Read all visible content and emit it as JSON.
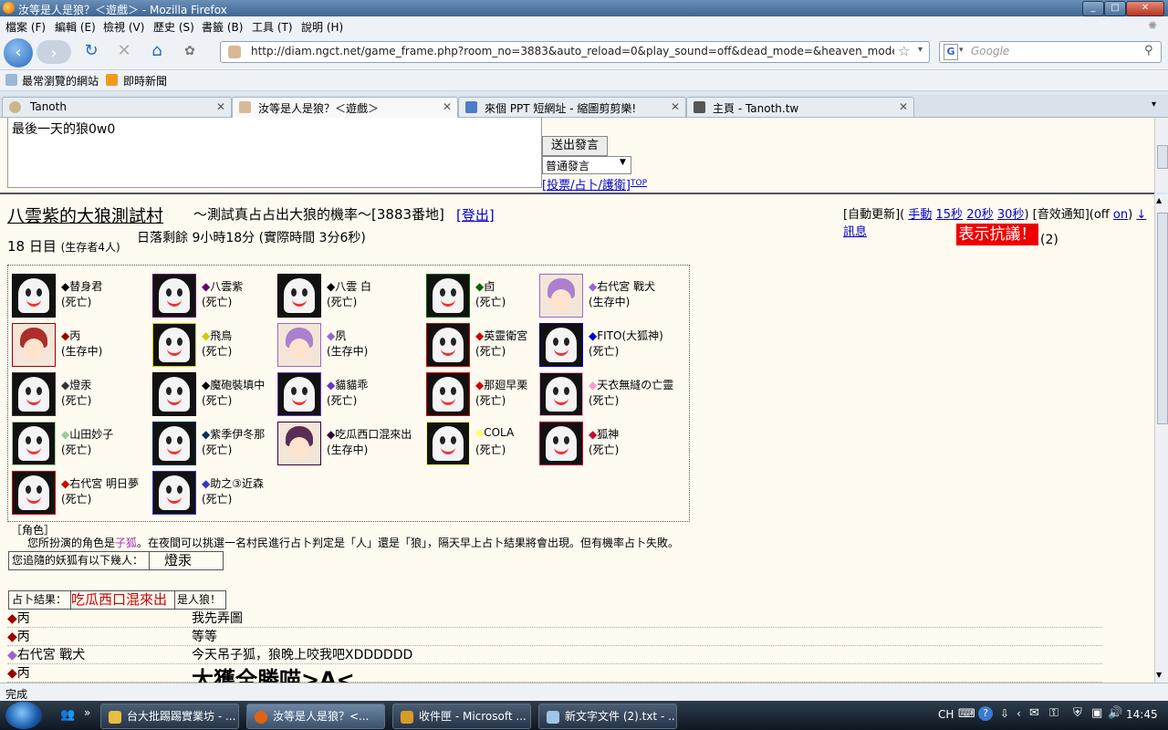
{
  "window": {
    "title": "汝等是人是狼？＜遊戲＞ - Mozilla Firefox"
  },
  "menu": [
    "檔案 (F)",
    "編輯 (E)",
    "檢視 (V)",
    "歷史 (S)",
    "書籤 (B)",
    "工具 (T)",
    "說明 (H)"
  ],
  "nav": {
    "url": "http://diam.ngct.net/game_frame.php?room_no=3883&auto_reload=0&play_sound=off&dead_mode=&heaven_mode=&l",
    "search_placeholder": "Google"
  },
  "bookmarks": [
    "最常瀏覽的網站",
    "即時新聞"
  ],
  "tabs": [
    {
      "label": "Tanoth",
      "active": false
    },
    {
      "label": "汝等是人是狼？＜遊戲＞",
      "active": true
    },
    {
      "label": "來個 PPT 短網址 - 縮圖剪剪樂!",
      "active": false
    },
    {
      "label": "主頁 - Tanoth.tw",
      "active": false
    }
  ],
  "speak": {
    "message": "最後一天的狼0w0",
    "send_label": "送出發言",
    "mode_value": "普通發言",
    "vote_link": "[投票/占卜/護衛]",
    "top_link": "TOP"
  },
  "game": {
    "village_name": "八雲紫的大狼測試村",
    "subtitle": "～測試真占占出大狼的機率～[3883番地]",
    "logout": "[登出]",
    "auto_update_prefix": "[自動更新](",
    "auto_update_links": [
      "手動",
      "15秒",
      "20秒",
      "30秒"
    ],
    "sound_prefix": ") [音效通知](off ",
    "sound_on": "on",
    "sound_suffix": ")",
    "message_link": "↓訊息",
    "protest_label": "表示抗議！",
    "protest_count": "(2)",
    "day": "18 日目",
    "survivors": "(生存者4人)",
    "sunset": "日落剩餘 9小時18分 (實際時間 3分6秒)"
  },
  "players": [
    {
      "name": "替身君",
      "status": "(死亡)",
      "color": "#000000",
      "avatar": "ghost"
    },
    {
      "name": "八雲紫",
      "status": "(死亡)",
      "color": "#660066",
      "avatar": "ghost"
    },
    {
      "name": "八雲 白",
      "status": "(死亡)",
      "color": "#000000",
      "avatar": "ghost"
    },
    {
      "name": "卣",
      "status": "(死亡)",
      "color": "#006600",
      "avatar": "ghost"
    },
    {
      "name": "右代宮 戰犬",
      "status": "(生存中)",
      "color": "#9966cc",
      "avatar": "face"
    },
    {
      "name": "丙",
      "status": "(生存中)",
      "color": "#990000",
      "avatar": "face"
    },
    {
      "name": "飛鳥",
      "status": "(死亡)",
      "color": "#cccc00",
      "avatar": "ghost"
    },
    {
      "name": "夙",
      "status": "(生存中)",
      "color": "#9966cc",
      "avatar": "face"
    },
    {
      "name": "英靈衛宮",
      "status": "(死亡)",
      "color": "#cc0000",
      "avatar": "ghost"
    },
    {
      "name": "FITO(大狐神)",
      "status": "(死亡)",
      "color": "#0000cc",
      "avatar": "ghost"
    },
    {
      "name": "燈汞",
      "status": "(死亡)",
      "color": "#333333",
      "avatar": "ghost"
    },
    {
      "name": "魔砲裝填中",
      "status": "(死亡)",
      "color": "#000000",
      "avatar": "ghost"
    },
    {
      "name": "貓貓乖",
      "status": "(死亡)",
      "color": "#6633cc",
      "avatar": "ghost"
    },
    {
      "name": "那廻早栗",
      "status": "(死亡)",
      "color": "#cc0000",
      "avatar": "ghost"
    },
    {
      "name": "天衣無縫の亡靈",
      "status": "(死亡)",
      "color": "#ff99cc",
      "avatar": "ghost"
    },
    {
      "name": "山田妙子",
      "status": "(死亡)",
      "color": "#99cc99",
      "avatar": "ghost"
    },
    {
      "name": "紫季伊冬那",
      "status": "(死亡)",
      "color": "#003366",
      "avatar": "ghost"
    },
    {
      "name": "吃瓜西口混來出",
      "status": "(生存中)",
      "color": "#330033",
      "avatar": "face"
    },
    {
      "name": "COLA",
      "status": "(死亡)",
      "color": "#ffff66",
      "avatar": "ghost"
    },
    {
      "name": "狐神",
      "status": "(死亡)",
      "color": "#cc0033",
      "avatar": "ghost"
    },
    {
      "name": "右代宮 明日夢",
      "status": "(死亡)",
      "color": "#cc0000",
      "avatar": "ghost"
    },
    {
      "name": "助之③近森",
      "status": "(死亡)",
      "color": "#3333cc",
      "avatar": "ghost"
    }
  ],
  "role": {
    "header": "［角色］",
    "desc_prefix": "您所扮演的角色是",
    "role_name": "子狐",
    "desc_suffix": "。在夜間可以挑選一名村民進行占卜判定是「人」還是「狼」，隔天早上占卜結果將會出現。但有機率占卜失敗。",
    "follow_label": "您追隨的妖狐有以下幾人：",
    "follow_name": "燈汞",
    "div_label": "占卜結果：",
    "div_target": "吃瓜西口混來出",
    "div_result": "是人狼！"
  },
  "talks": [
    {
      "speaker": "丙",
      "color": "#990000",
      "text": "我先弄圖"
    },
    {
      "speaker": "丙",
      "color": "#990000",
      "text": "等等"
    },
    {
      "speaker": "右代宮 戰犬",
      "color": "#9966cc",
      "text": "今天吊子狐，狼晚上咬我吧XDDDDDD"
    },
    {
      "speaker": "丙",
      "color": "#990000",
      "text": "大獲全勝喵>A<"
    }
  ],
  "status": "完成",
  "taskbar": {
    "tasks": [
      "台大批踢踢實業坊 - ...",
      "汝等是人是狼？<...",
      "收件匣 - Microsoft ...",
      "新文字文件 (2).txt - ..."
    ],
    "lang": "CH",
    "clock": "14:45"
  }
}
